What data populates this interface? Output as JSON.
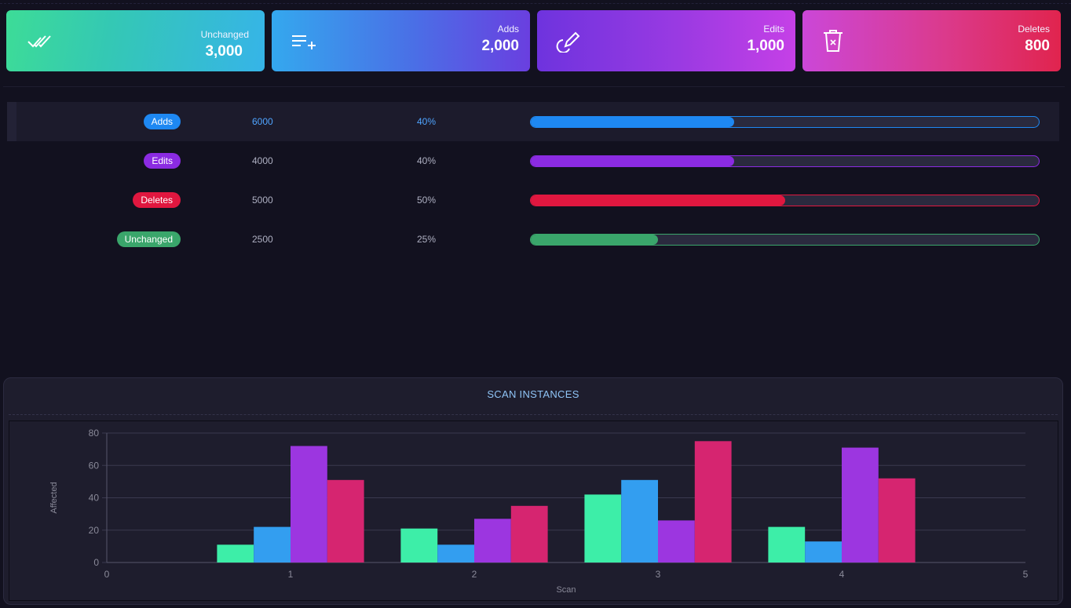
{
  "summary_cards": [
    {
      "key": "unchanged",
      "label": "Unchanged",
      "value": "3,000",
      "icon": "double-check-icon"
    },
    {
      "key": "adds",
      "label": "Adds",
      "value": "2,000",
      "icon": "playlist-add-icon"
    },
    {
      "key": "edits",
      "label": "Edits",
      "value": "1,000",
      "icon": "pencil-icon"
    },
    {
      "key": "deletes",
      "label": "Deletes",
      "value": "800",
      "icon": "trash-icon"
    }
  ],
  "stats": [
    {
      "label": "Adds",
      "count": "6000",
      "percent": "40%",
      "fraction": 0.4,
      "color": "#1e88f2"
    },
    {
      "label": "Edits",
      "count": "4000",
      "percent": "40%",
      "fraction": 0.4,
      "color": "#8b2be2"
    },
    {
      "label": "Deletes",
      "count": "5000",
      "percent": "50%",
      "fraction": 0.5,
      "color": "#e0173f"
    },
    {
      "label": "Unchanged",
      "count": "2500",
      "percent": "25%",
      "fraction": 0.25,
      "color": "#3aa66b"
    }
  ],
  "panel": {
    "title": "SCAN INSTANCES"
  },
  "chart_data": {
    "type": "bar",
    "x": [
      1,
      2,
      3,
      4
    ],
    "xlabel": "Scan",
    "ylabel": "Affected",
    "xlim": [
      0,
      5
    ],
    "ylim": [
      0,
      80
    ],
    "xticks": [
      "0",
      "1",
      "2",
      "3",
      "4",
      "5"
    ],
    "yticks": [
      "0",
      "20",
      "40",
      "60",
      "80"
    ],
    "grid": true,
    "series": [
      {
        "values": [
          11,
          21,
          42,
          22
        ],
        "color": "#3deea8"
      },
      {
        "values": [
          22,
          11,
          51,
          13
        ],
        "color": "#339ef0"
      },
      {
        "values": [
          72,
          27,
          26,
          71
        ],
        "color": "#9c36e0"
      },
      {
        "values": [
          51,
          35,
          75,
          52
        ],
        "color": "#d62570"
      }
    ]
  }
}
